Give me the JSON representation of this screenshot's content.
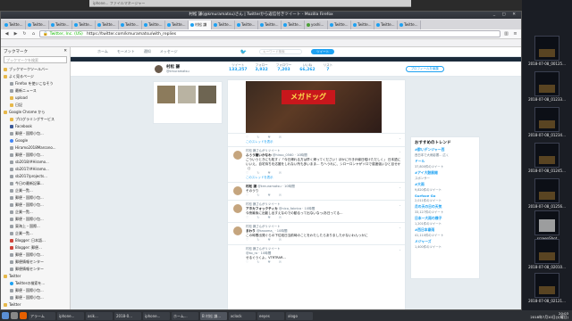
{
  "desktop": {
    "files": [
      {
        "label": "2018-07-08_00125..."
      },
      {
        "label": "2018-07-08_01233..."
      },
      {
        "label": "2018-07-08_01234..."
      },
      {
        "label": "2018-07-08_01245..."
      },
      {
        "label": "2018-07-08_01256..."
      },
      {
        "label": "screenShot"
      },
      {
        "label": "2018-07-08_02010..."
      },
      {
        "label": "2018-07-08_02121..."
      }
    ]
  },
  "back_window": {
    "title": "iphone... ファイルマネージャー"
  },
  "window": {
    "title": "村松 謙(@kmuramatsu)さん | Twitterから返信付きツイート - Mozilla Firefox"
  },
  "tabs": [
    {
      "label": "Twitte..."
    },
    {
      "label": "Twitte..."
    },
    {
      "label": "Twitte..."
    },
    {
      "label": "Twitte..."
    },
    {
      "label": "Twitte..."
    },
    {
      "label": "Twitte..."
    },
    {
      "label": "Twitte..."
    },
    {
      "label": "Twitte..."
    },
    {
      "label": "村松 謙"
    },
    {
      "label": "Twitte..."
    },
    {
      "label": "Twitte..."
    },
    {
      "label": "Twitte..."
    },
    {
      "label": "Twitte..."
    },
    {
      "label": "yoshi..."
    },
    {
      "label": "Twitte..."
    },
    {
      "label": "Twitte..."
    },
    {
      "label": "Twitte..."
    },
    {
      "label": "Twitte..."
    }
  ],
  "nav": {
    "url": "https://twitter.com/kmuramatsu/with_replies",
    "site": "Twitter, Inc. (US)"
  },
  "sidebar": {
    "title": "ブックマーク",
    "search_placeholder": "ブックマークを検索",
    "items": [
      {
        "label": "ブックマークツールバー",
        "icon": "folder"
      },
      {
        "label": "よく見るページ",
        "icon": "folder"
      },
      {
        "label": "Firefox を使いこなそう",
        "icon": "page"
      },
      {
        "label": "最新ニュース",
        "icon": "page"
      },
      {
        "label": "upload",
        "icon": "folder"
      },
      {
        "label": "日記",
        "icon": "folder"
      },
      {
        "label": "Google Chrome から",
        "icon": "folder"
      },
      {
        "label": "プログラミングサービス",
        "icon": "folder"
      },
      {
        "label": "Facebook",
        "icon": "fb"
      },
      {
        "label": "郵便・国際小包...",
        "icon": "page"
      },
      {
        "label": "Google",
        "icon": "g"
      },
      {
        "label": "Hiramo2018Marcono...",
        "icon": "page"
      },
      {
        "label": "郵便・国際小包...",
        "icon": "page"
      },
      {
        "label": "sb2018/#Hiramo...",
        "icon": "page"
      },
      {
        "label": "sb2017/#Hiramo...",
        "icon": "page"
      },
      {
        "label": "sb2017/projects...",
        "icon": "page"
      },
      {
        "label": "今日の最新記事...",
        "icon": "page"
      },
      {
        "label": "企業一覧...",
        "icon": "page"
      },
      {
        "label": "郵便・国際小包...",
        "icon": "page"
      },
      {
        "label": "郵便・国際小包...",
        "icon": "page"
      },
      {
        "label": "企業一覧...",
        "icon": "page"
      },
      {
        "label": "郵便・国際小包...",
        "icon": "page"
      },
      {
        "label": "東海上・国際...",
        "icon": "page"
      },
      {
        "label": "企業一覧...",
        "icon": "page"
      },
      {
        "label": "Blogger: 日本語...",
        "icon": "pk"
      },
      {
        "label": "Blogger: 郵便...",
        "icon": "pk"
      },
      {
        "label": "郵便・国際小包...",
        "icon": "page"
      },
      {
        "label": "郵便情報センター",
        "icon": "page"
      },
      {
        "label": "郵便情報センター",
        "icon": "page"
      },
      {
        "label": "Twitter",
        "icon": "folder"
      },
      {
        "label": "Twitterの検索を...",
        "icon": "tw"
      },
      {
        "label": "郵便・国際小包...",
        "icon": "page"
      },
      {
        "label": "郵便・国際小包...",
        "icon": "page"
      },
      {
        "label": "Twitter",
        "icon": "folder"
      },
      {
        "label": "...",
        "icon": "page"
      }
    ]
  },
  "twitter": {
    "nav": [
      "ホーム",
      "モーメント",
      "通知",
      "メッセージ"
    ],
    "search_placeholder": "キーワード検索",
    "tweet_button": "ツイート",
    "profile": {
      "name": "村松 謙",
      "handle": "@kmuramatsu",
      "stats": [
        {
          "label": "ツイート",
          "value": "133,257"
        },
        {
          "label": "フォロー",
          "value": "3,932"
        },
        {
          "label": "フォロワー",
          "value": "7,203"
        },
        {
          "label": "いいね",
          "value": "66,262"
        },
        {
          "label": "リスト",
          "value": "7"
        }
      ],
      "follow_button": "プロフィールを編集"
    },
    "photo_sign": "メガドッグ",
    "tweets": [
      {
        "ctx": "",
        "who": "",
        "handle": "",
        "text": "",
        "thread": "このスレッドを表示",
        "acts": "♡ ↻ ♥ ✉"
      },
      {
        "ctx": "村松 謙さんがリツイート",
        "who": "ふぅう糖いかなわ",
        "handle": "@hiroo_0560 · 10時間",
        "text": "ごういうときにも知す / 「今日帰れる方は早く帰ってください！ほかに行き戸締日昭けただしく」 日本語にいいえ、自宅待ちを応援をしれない所も多いまま... ちへうれに、シローロンヤがソロで感度強いひと目せか（）",
        "thread": "このスレッドを表示",
        "acts": "♡ ↻ ♥ ✉"
      },
      {
        "ctx": "",
        "who": "村松 謙",
        "handle": "@kmuramatsu · 10時間",
        "text": "そのうり",
        "thread": "",
        "acts": "♡ ↻ ♥ ✉"
      },
      {
        "ctx": "村松 謙さんがリツイート",
        "who": "アホカフォックティカ",
        "handle": "@nico_fabrica · 10時間",
        "text": "今夜最後に出動し出すえなのでの動るって出ないなっ/あ日ってる...",
        "thread": "",
        "acts": "♡ ↻ ♥ ✉"
      },
      {
        "ctx": "村松 謙さんがリツイート",
        "who": "まわり",
        "handle": "@kasama_ · 10時間",
        "text": "この時間出発ぐらの下位段日当前時のことをわたしたらありましたかないわんっかに",
        "thread": "",
        "acts": "♡ ↻ ♥ ✉"
      },
      {
        "ctx": "村松 謙さんがリツイート",
        "who": "",
        "handle": "@ko_ro · 10時間",
        "text": "せるぐうくよ。VTRTRAR...",
        "thread": "",
        "acts": "♡ ↻ ♥ ✉"
      }
    ],
    "trends_title": "おすすめのトレンド",
    "trends": [
      {
        "name": "#酔いデンジャー西",
        "count": "西日本で大雨影響... 広く"
      },
      {
        "name": "ドール",
        "count": "37,800件のツイート"
      },
      {
        "name": "#アイ大鼓展開",
        "count": "スポンサー"
      },
      {
        "name": "#大雨",
        "count": "9,820件のツイート"
      },
      {
        "name": "Surface Go",
        "count": "2,011件のツイート"
      },
      {
        "name": "月の天の日の天気",
        "count": "33,127件のツイート"
      },
      {
        "name": "日本ー大雨の様子",
        "count": "1,201件のツイート"
      },
      {
        "name": "#西日本豪雨",
        "count": "41,110件のツイート"
      },
      {
        "name": "メジャーズ",
        "count": "1,400件のツイート"
      }
    ]
  },
  "taskbar": {
    "tasks": [
      "アラーム",
      "iphone...",
      "asik...",
      "2018-0...",
      "iphone...",
      "ホーム...",
      "B 村松 謙...",
      "xclock",
      "eeyes",
      "xlogo"
    ],
    "clock_time": "20:03",
    "clock_date": "2018年7月10日(火曜日)"
  }
}
